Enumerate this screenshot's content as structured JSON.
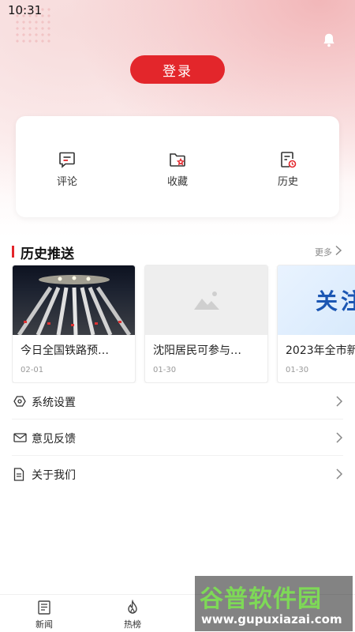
{
  "status_bar": {
    "time": "10:31"
  },
  "header": {
    "login_label": "登录"
  },
  "quick_actions": [
    {
      "label": "评论",
      "icon": "comment-icon"
    },
    {
      "label": "收藏",
      "icon": "folder-star-icon"
    },
    {
      "label": "历史",
      "icon": "history-icon"
    }
  ],
  "history_section": {
    "title": "历史推送",
    "more_label": "更多",
    "items": [
      {
        "title": "今日全国铁路预…",
        "date": "02-01",
        "image": "train-station-night-photo"
      },
      {
        "title": "沈阳居民可参与…",
        "date": "01-30",
        "image": "placeholder-image-icon"
      },
      {
        "title": "2023年全市新",
        "date": "01-30",
        "image": "banner-关注",
        "image_text": "关注"
      }
    ]
  },
  "menu": [
    {
      "label": "系统设置",
      "icon": "settings-icon"
    },
    {
      "label": "意见反馈",
      "icon": "mail-icon"
    },
    {
      "label": "关于我们",
      "icon": "document-icon"
    }
  ],
  "tabbar": [
    {
      "label": "新闻",
      "icon": "news-icon"
    },
    {
      "label": "热榜",
      "icon": "flame-icon"
    }
  ],
  "watermark": {
    "line1": "谷普软件园",
    "line2": "www.gupuxiazai.com"
  },
  "colors": {
    "accent": "#e3262b"
  }
}
